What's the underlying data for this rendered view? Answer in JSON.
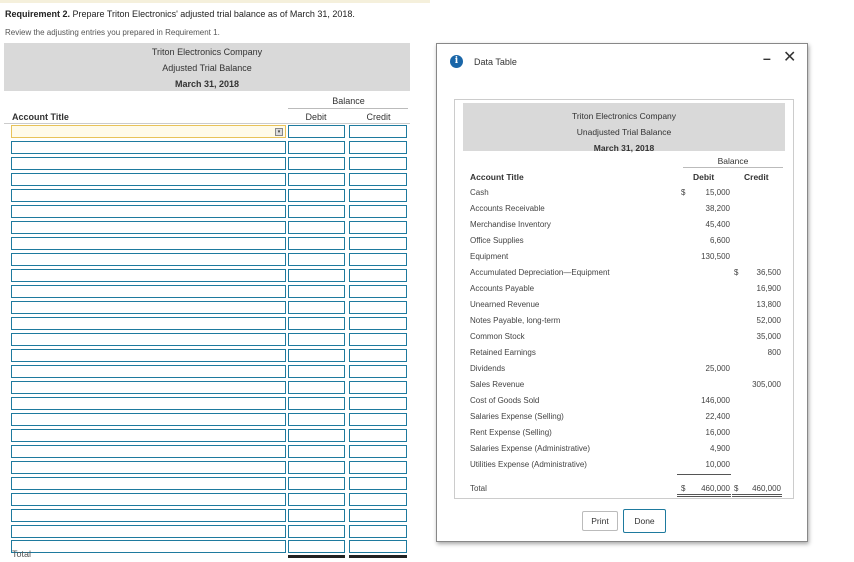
{
  "requirement": {
    "label": "Requirement 2.",
    "text": " Prepare Triton Electronics' adjusted trial balance as of March 31, 2018.",
    "subtext": "Review the adjusting entries you prepared in Requirement 1."
  },
  "worksheet": {
    "company": "Triton Electronics Company",
    "title": "Adjusted Trial Balance",
    "date": "March 31, 2018",
    "balance_label": "Balance",
    "col_account": "Account Title",
    "col_debit": "Debit",
    "col_credit": "Credit",
    "dropdown_glyph": "▾",
    "row_count": 27,
    "total_label": "Total"
  },
  "popup": {
    "title": "Data Table",
    "info_glyph": "i",
    "minimize_glyph": "–",
    "close_glyph": "✕",
    "company": "Triton Electronics Company",
    "table_title": "Unadjusted Trial Balance",
    "date": "March 31, 2018",
    "balance_label": "Balance",
    "col_account": "Account Title",
    "col_debit": "Debit",
    "col_credit": "Credit",
    "accounts": [
      {
        "name": "Cash",
        "debit_sign": "$",
        "debit": "15,000",
        "credit_sign": "",
        "credit": ""
      },
      {
        "name": "Accounts Receivable",
        "debit_sign": "",
        "debit": "38,200",
        "credit_sign": "",
        "credit": ""
      },
      {
        "name": "Merchandise Inventory",
        "debit_sign": "",
        "debit": "45,400",
        "credit_sign": "",
        "credit": ""
      },
      {
        "name": "Office Supplies",
        "debit_sign": "",
        "debit": "6,600",
        "credit_sign": "",
        "credit": ""
      },
      {
        "name": "Equipment",
        "debit_sign": "",
        "debit": "130,500",
        "credit_sign": "",
        "credit": ""
      },
      {
        "name": "Accumulated Depreciation—Equipment",
        "debit_sign": "",
        "debit": "",
        "credit_sign": "$",
        "credit": "36,500"
      },
      {
        "name": "Accounts Payable",
        "debit_sign": "",
        "debit": "",
        "credit_sign": "",
        "credit": "16,900"
      },
      {
        "name": "Unearned Revenue",
        "debit_sign": "",
        "debit": "",
        "credit_sign": "",
        "credit": "13,800"
      },
      {
        "name": "Notes Payable, long-term",
        "debit_sign": "",
        "debit": "",
        "credit_sign": "",
        "credit": "52,000"
      },
      {
        "name": "Common Stock",
        "debit_sign": "",
        "debit": "",
        "credit_sign": "",
        "credit": "35,000"
      },
      {
        "name": "Retained Earnings",
        "debit_sign": "",
        "debit": "",
        "credit_sign": "",
        "credit": "800"
      },
      {
        "name": "Dividends",
        "debit_sign": "",
        "debit": "25,000",
        "credit_sign": "",
        "credit": ""
      },
      {
        "name": "Sales Revenue",
        "debit_sign": "",
        "debit": "",
        "credit_sign": "",
        "credit": "305,000"
      },
      {
        "name": "Cost of Goods Sold",
        "debit_sign": "",
        "debit": "146,000",
        "credit_sign": "",
        "credit": ""
      },
      {
        "name": "Salaries Expense (Selling)",
        "debit_sign": "",
        "debit": "22,400",
        "credit_sign": "",
        "credit": ""
      },
      {
        "name": "Rent Expense (Selling)",
        "debit_sign": "",
        "debit": "16,000",
        "credit_sign": "",
        "credit": ""
      },
      {
        "name": "Salaries Expense (Administrative)",
        "debit_sign": "",
        "debit": "4,900",
        "credit_sign": "",
        "credit": ""
      },
      {
        "name": "Utilities Expense (Administrative)",
        "debit_sign": "",
        "debit": "10,000",
        "credit_sign": "",
        "credit": ""
      }
    ],
    "total": {
      "name": "Total",
      "debit_sign": "$",
      "debit": "460,000",
      "credit_sign": "$",
      "credit": "460,000"
    },
    "print_label": "Print",
    "done_label": "Done"
  }
}
